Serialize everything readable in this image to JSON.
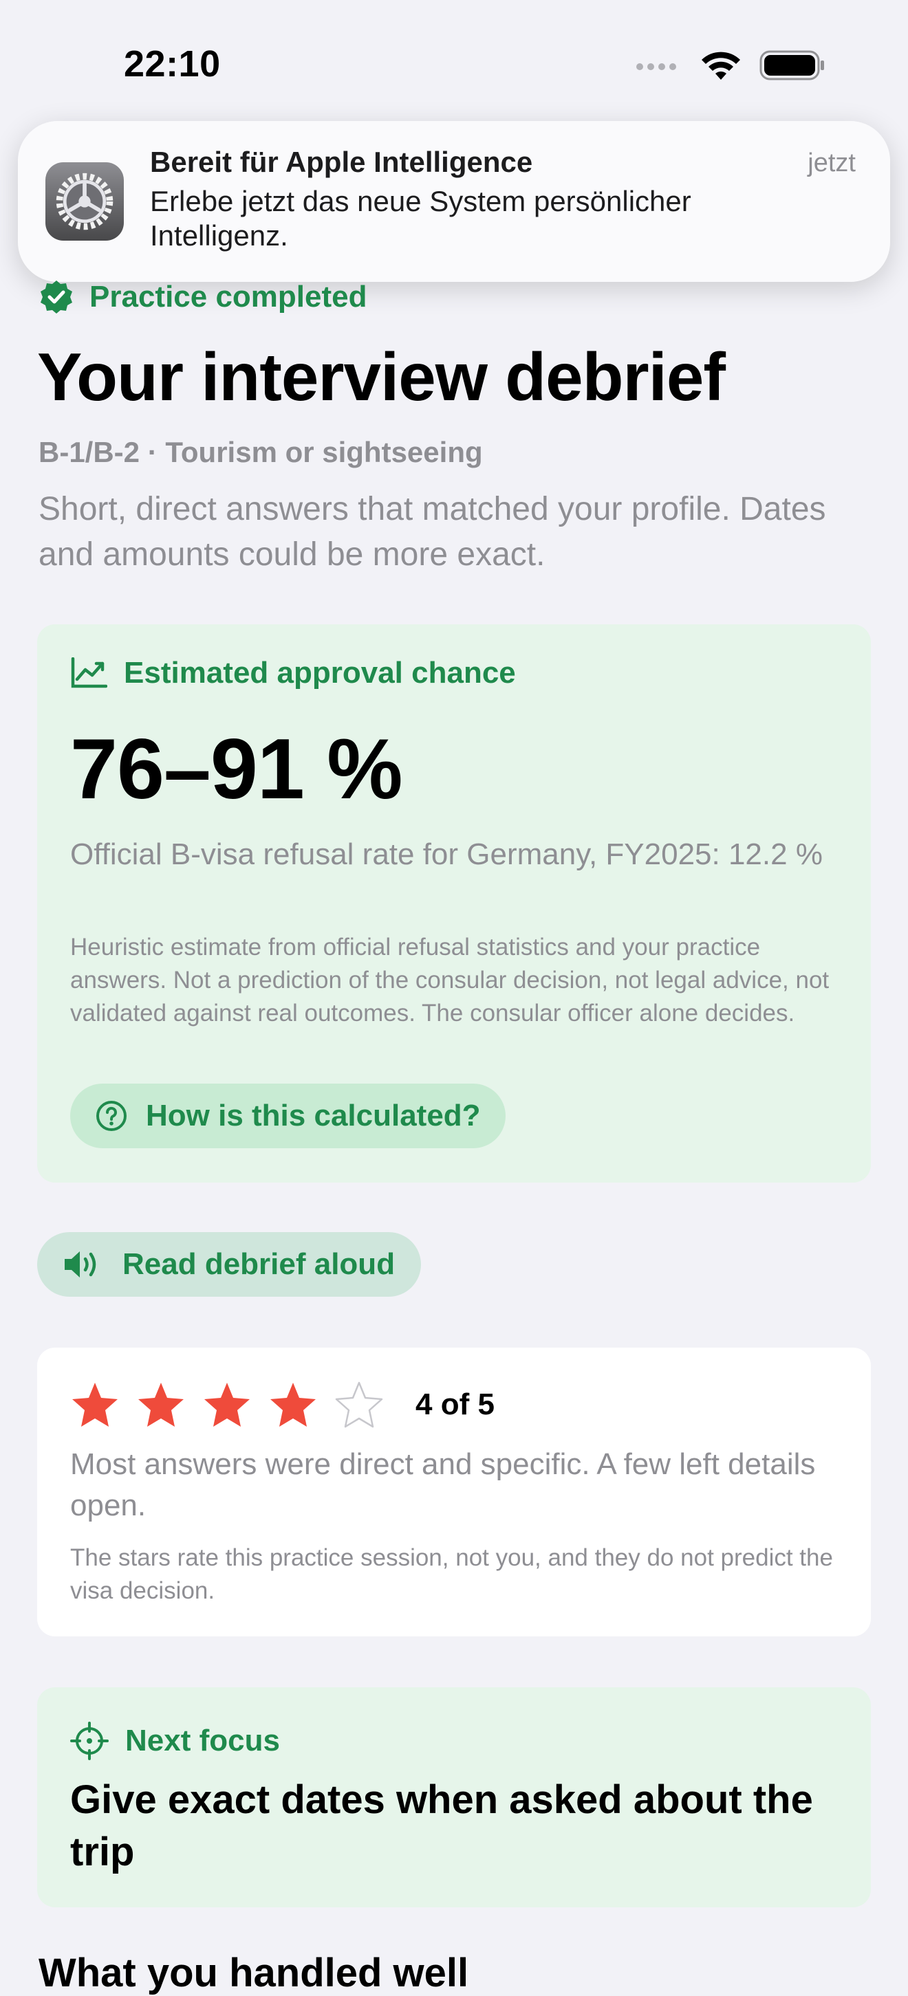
{
  "status_bar": {
    "time": "22:10"
  },
  "notification": {
    "title": "Bereit für Apple Intelligence",
    "body": "Erlebe jetzt das neue System persönlicher Intelligenz.",
    "time": "jetzt",
    "icon": "settings-gear-icon"
  },
  "header": {
    "completed_label": "Practice completed",
    "title": "Your interview debrief",
    "subtitle": "B-1/B-2 · Tourism or sightseeing",
    "summary": "Short, direct answers that matched your profile. Dates and amounts could be more exact."
  },
  "approval": {
    "label": "Estimated approval chance",
    "range": "76–91 %",
    "refusal_note": "Official B-visa refusal rate for Germany, FY2025: 12.2 %",
    "disclaimer": "Heuristic estimate from official refusal statistics and your practice answers. Not a prediction of the consular decision, not legal advice, not validated against real outcomes. The consular officer alone decides.",
    "calc_button": "How is this calculated?"
  },
  "read_aloud": {
    "label": "Read debrief aloud"
  },
  "rating": {
    "stars_filled": 4,
    "stars_total": 5,
    "text": "4 of 5",
    "summary": "Most answers were direct and specific. A few left details open.",
    "note": "The stars rate this practice session, not you, and they do not predict the visa decision."
  },
  "next_focus": {
    "label": "Next focus",
    "text": "Give exact dates when asked about the trip"
  },
  "next_section": {
    "heading": "What you handled well"
  },
  "colors": {
    "accent_green": "#1f8a4c",
    "card_green": "#e6f5ea",
    "star_red": "#ef4b3b",
    "background": "#f2f2f7"
  }
}
